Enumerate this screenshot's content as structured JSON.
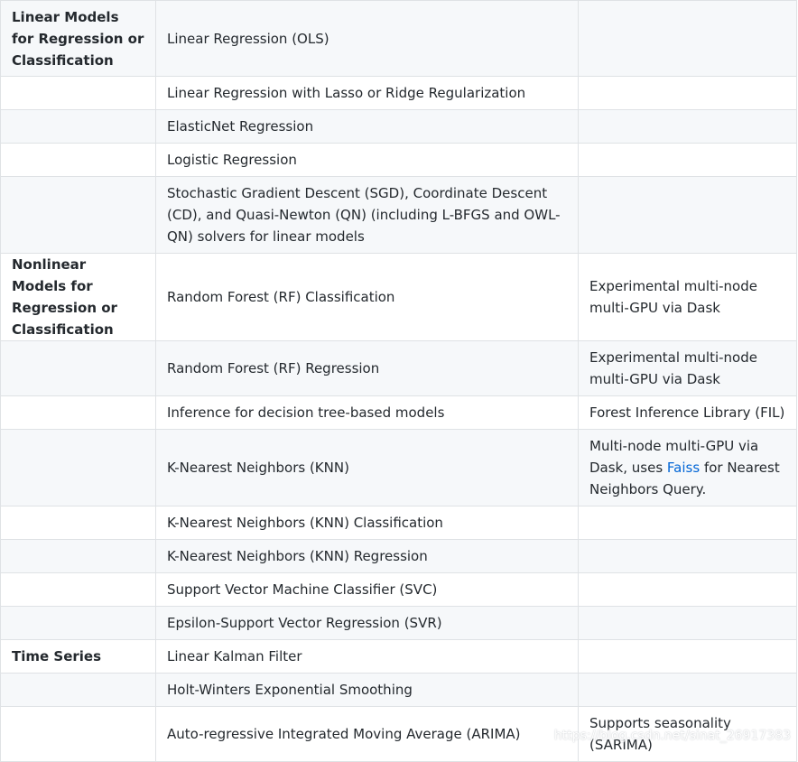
{
  "rows": [
    {
      "category": "Linear Models for Regression or Classification",
      "algorithm": "Linear Regression (OLS)",
      "notes": ""
    },
    {
      "category": "",
      "algorithm": "Linear Regression with Lasso or Ridge Regularization",
      "notes": ""
    },
    {
      "category": "",
      "algorithm": "ElasticNet Regression",
      "notes": ""
    },
    {
      "category": "",
      "algorithm": "Logistic Regression",
      "notes": ""
    },
    {
      "category": "",
      "algorithm": "Stochastic Gradient Descent (SGD), Coordinate Descent (CD), and Quasi-Newton (QN) (including L-BFGS and OWL-QN) solvers for linear models",
      "notes": ""
    },
    {
      "category": "Nonlinear Models for Regression or Classification",
      "algorithm": "Random Forest (RF) Classification",
      "notes": "Experimental multi-node multi-GPU via Dask"
    },
    {
      "category": "",
      "algorithm": "Random Forest (RF) Regression",
      "notes": "Experimental multi-node multi-GPU via Dask"
    },
    {
      "category": "",
      "algorithm": "Inference for decision tree-based models",
      "notes": "Forest Inference Library (FIL)"
    },
    {
      "category": "",
      "algorithm": "K-Nearest Neighbors (KNN)",
      "notes_before": "Multi-node multi-GPU via Dask, uses ",
      "notes_link": "Faiss",
      "notes_after": " for Nearest Neighbors Query."
    },
    {
      "category": "",
      "algorithm": "K-Nearest Neighbors (KNN) Classification",
      "notes": ""
    },
    {
      "category": "",
      "algorithm": "K-Nearest Neighbors (KNN) Regression",
      "notes": ""
    },
    {
      "category": "",
      "algorithm": "Support Vector Machine Classifier (SVC)",
      "notes": ""
    },
    {
      "category": "",
      "algorithm": "Epsilon-Support Vector Regression (SVR)",
      "notes": ""
    },
    {
      "category": "Time Series",
      "algorithm": "Linear Kalman Filter",
      "notes": ""
    },
    {
      "category": "",
      "algorithm": "Holt-Winters Exponential Smoothing",
      "notes": ""
    },
    {
      "category": "",
      "algorithm": "Auto-regressive Integrated Moving Average (ARIMA)",
      "notes": "Supports seasonality (SARIMA)"
    }
  ],
  "watermark": "https://blog.csdn.net/sinat_26917383"
}
